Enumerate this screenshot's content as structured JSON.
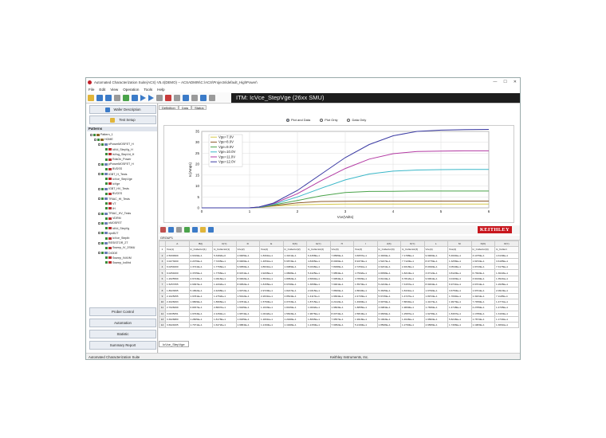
{
  "window": {
    "title": "Automated Characterization Suite(ACS) V5.4(DEMO) -- ACSADMIN\\C:\\ACS\\Projects\\default_HighPower\\",
    "controls": [
      "—",
      "☐",
      "✕"
    ]
  },
  "menu": [
    "File",
    "Edit",
    "View",
    "Operation",
    "Tools",
    "Help"
  ],
  "itm_title": "ITM: IcVce_StepVge (26xx SMU)",
  "left_panel": {
    "wafer_description": "Wafer Description",
    "test_setup": "Test Setup",
    "patterns_header": "Patterns",
    "tree": [
      {
        "label": "Pattern_1",
        "level": 1,
        "kind": "group"
      },
      {
        "label": "HOME",
        "level": 2,
        "kind": "group"
      },
      {
        "label": "nPowerMOSFET_H",
        "level": 3,
        "kind": "dev"
      },
      {
        "label": "IdVd_StepVg_H",
        "level": 4,
        "kind": "itm"
      },
      {
        "label": "IsVsg_StepVd_H",
        "level": 4,
        "kind": "itm"
      },
      {
        "label": "RdsOn_Power",
        "level": 4,
        "kind": "itm"
      },
      {
        "label": "pPowerMOSFET_H",
        "level": 3,
        "kind": "dev"
      },
      {
        "label": "BVDSS",
        "level": 4,
        "kind": "itm"
      },
      {
        "label": "IGBT_H_Tests",
        "level": 3,
        "kind": "dev"
      },
      {
        "label": "IcVce_StepVge",
        "level": 4,
        "kind": "itm"
      },
      {
        "label": "IcVge",
        "level": 4,
        "kind": "itm"
      },
      {
        "label": "IGBT_HV_Tests",
        "level": 3,
        "kind": "dev"
      },
      {
        "label": "BVCES",
        "level": 4,
        "kind": "itm"
      },
      {
        "label": "TRIAC_HI_Tests",
        "level": 3,
        "kind": "dev"
      },
      {
        "label": "VT",
        "level": 4,
        "kind": "itm"
      },
      {
        "label": "IH",
        "level": 4,
        "kind": "itm"
      },
      {
        "label": "TRIAC_HV_Tests",
        "level": 3,
        "kind": "dev"
      },
      {
        "label": "VDRM",
        "level": 4,
        "kind": "itm"
      },
      {
        "label": "nMOSFET",
        "level": 3,
        "kind": "dev"
      },
      {
        "label": "IdVd_StepVg",
        "level": 4,
        "kind": "itm"
      },
      {
        "label": "npnBJT",
        "level": 3,
        "kind": "dev"
      },
      {
        "label": "IcVce_StepIb",
        "level": 4,
        "kind": "itm"
      },
      {
        "label": "RESISTOR_2T",
        "level": 3,
        "kind": "dev"
      },
      {
        "label": "Sweep_IV_2SMU",
        "level": 4,
        "kind": "itm"
      },
      {
        "label": "DIODE",
        "level": 3,
        "kind": "dev"
      },
      {
        "label": "Sweep_IVdVM",
        "level": 4,
        "kind": "itm"
      },
      {
        "label": "Sweep_IvdVrd",
        "level": 4,
        "kind": "itm"
      }
    ],
    "bottom_buttons": [
      "Prober Control",
      "Automation",
      "Statistic",
      "Summary Report"
    ]
  },
  "tabs": [
    "Definition",
    "Data",
    "Status"
  ],
  "active_tab": "Data",
  "radios": [
    {
      "label": "Plot and Data",
      "selected": true
    },
    {
      "label": "Plot Only",
      "selected": false
    },
    {
      "label": "Data Only",
      "selected": false
    }
  ],
  "chart_data": {
    "type": "line",
    "xlabel": "Vce(Volts)",
    "ylabel": "Ic(Amps)",
    "xlim": [
      0,
      6
    ],
    "ylim": [
      0,
      35
    ],
    "xticks": [
      0,
      1,
      2,
      3,
      4,
      5,
      6
    ],
    "yticks": [
      0,
      5,
      10,
      15,
      20,
      25,
      30,
      35
    ],
    "grid": true,
    "legend_position": "top-left",
    "x": [
      0,
      0.5,
      1.0,
      1.2,
      1.5,
      2.0,
      2.5,
      3.0,
      3.5,
      4.0,
      4.5,
      5.0,
      5.5,
      6.0
    ],
    "series": [
      {
        "name": "Vge=7.0V",
        "color": "#d7c94a",
        "values": [
          0,
          0,
          0,
          0.2,
          0.8,
          1.4,
          1.6,
          1.7,
          1.7,
          1.7,
          1.7,
          1.7,
          1.7,
          1.7
        ]
      },
      {
        "name": "Vge=8.0V",
        "color": "#8b5a2b",
        "values": [
          0,
          0,
          0,
          0.2,
          1.0,
          2.3,
          2.9,
          3.0,
          3.1,
          3.1,
          3.1,
          3.1,
          3.1,
          3.1
        ]
      },
      {
        "name": "Vge=9.0V",
        "color": "#4aa34a",
        "values": [
          0,
          0,
          0,
          0.3,
          1.3,
          3.4,
          5.5,
          7.0,
          7.5,
          7.6,
          7.7,
          7.7,
          7.7,
          7.7
        ]
      },
      {
        "name": "Vge=10.0V",
        "color": "#3ab7c8",
        "values": [
          0,
          0,
          0,
          0.3,
          1.6,
          5.0,
          9.0,
          12.8,
          15.5,
          16.8,
          17.3,
          17.5,
          17.6,
          17.6
        ]
      },
      {
        "name": "Vge=11.0V",
        "color": "#b33aa3",
        "values": [
          0,
          0,
          0,
          0.4,
          1.9,
          6.5,
          12.5,
          18.0,
          22.3,
          24.8,
          25.8,
          26.0,
          26.1,
          26.1
        ]
      },
      {
        "name": "Vge=12.0V",
        "color": "#3a3aa3",
        "values": [
          0,
          0,
          0,
          0.4,
          2.2,
          8.0,
          15.5,
          23.0,
          29.0,
          33.0,
          35.0,
          35.6,
          35.8,
          35.9
        ]
      }
    ]
  },
  "brand": "KEITHLEY",
  "sheet": {
    "group_label": "GROUP1",
    "columns": [
      "A",
      "B(I)",
      "C(Y)",
      "D",
      "E",
      "F(X)",
      "G(Y)",
      "H",
      "I",
      "J(X)",
      "K(Y)",
      "L",
      "M",
      "N(X)",
      "O(Y)"
    ],
    "header_row": [
      "Vce(1)",
      "Ic_Collector(1)",
      "Ic_Collector(1)",
      "Vce(2)",
      "Vce(2)",
      "Ic_Collector(2)",
      "Ic_Collector(2)",
      "Vce(3)",
      "Vce(3)",
      "Ic_Collector(3)",
      "Ic_Collector(3)",
      "Vce(4)",
      "Vce(4)",
      "Ic_Collector(4)",
      "Ic_Collect"
    ],
    "rows": [
      [
        "2.5099999",
        "4.6199E+1",
        "5.3482E+0",
        "4.9905E+1",
        "1.8301E+1",
        "1.3161E+1",
        "6.4458E+1",
        "7.8895E+1",
        "3.6657E+1",
        "2.3466E+1",
        "7.1788E+1",
        "9.9906E+1",
        "5.4604E+1",
        "3.1075E+1",
        "4.3139E+1"
      ],
      [
        "3.0273000",
        "2.2076E+1",
        "7.7205E+1",
        "8.9906E+1",
        "1.4651E+1",
        "5.6873E+1",
        "4.8465E+1",
        "8.0006E+1",
        "8.9370E+1",
        "1.5227E+1",
        "7.7120E+1",
        "8.9775E+1",
        "1.3256E+1",
        "1.6972E+1",
        "3.6185E+1"
      ],
      [
        "6.0254000",
        "1.3741E+1",
        "1.7766E+1",
        "9.9950E+1",
        "4.8631E+1",
        "1.0089E+1",
        "5.0346E+1",
        "7.8938E+1",
        "2.7251E+1",
        "2.9231E+1",
        "2.4018E+1",
        "8.0490E+1",
        "3.0540E+1",
        "1.9723E+1",
        "7.3176E+1"
      ],
      [
        "9.0254000",
        "2.3705E+1",
        "1.7766E+1",
        "8.9151E+1",
        "4.9206E+1",
        "1.0808E+1",
        "5.4425E+1",
        "7.9854E+1",
        "4.7502E+1",
        "2.8458E+1",
        "1.8210E+1",
        "3.0712E+1",
        "3.8120E+1",
        "6.7302E+1",
        "1.3022E+1"
      ],
      [
        "1.2025599",
        "2.6743E+1",
        "1.0916E+1",
        "8.9902E+1",
        "1.5531E+1",
        "1.8052E+1",
        "2.6664E+1",
        "7.9954E+1",
        "4.7803E+1",
        "3.8144E+1",
        "6.7812E+1",
        "9.6991E+1",
        "3.0163E+1",
        "3.6019E+1",
        "1.3521E+1"
      ],
      [
        "1.5257055",
        "2.6997E+1",
        "1.2202E+1",
        "8.9952E+1",
        "1.8155E+1",
        "6.6708E+1",
        "1.3658E+1",
        "7.9901E+1",
        "1.5570E+1",
        "5.2223E+1",
        "7.3157E+1",
        "8.9934E+1",
        "6.9731E+1",
        "4.6701E+1",
        "1.2935E+1"
      ],
      [
        "1.8023695",
        "5.1862E+1",
        "2.4298E+1",
        "1.9972E+1",
        "2.9729E+1",
        "1.8247E+1",
        "2.0315E+1",
        "7.8660E+1",
        "2.8840E+1",
        "5.3635E+1",
        "1.8431E+1",
        "1.6790E+1",
        "3.6750E+1",
        "1.9701E+1",
        "2.0913E+1"
      ],
      [
        "2.1025055",
        "1.9781E+1",
        "1.2752E+1",
        "1.5912E+1",
        "2.2631E+1",
        "4.8524E+1",
        "1.4117E+1",
        "1.9664E+1",
        "2.4733E+1",
        "5.6745E+1",
        "1.4727E+1",
        "1.8972E+1",
        "1.7094E+1",
        "1.3181E+1",
        "7.1125E+1"
      ],
      [
        "2.4026093",
        "1.9809E+1",
        "1.8966E+1",
        "1.9781E+1",
        "1.5760E+1",
        "2.0733E+1",
        "1.8715E+1",
        "2.2142E+1",
        "1.4990E+1",
        "3.9979E+1",
        "7.8834E+1",
        "1.4137E+1",
        "1.9973E+1",
        "7.7459E+1",
        "1.4771E+1"
      ],
      [
        "2.7026099",
        "6.8457E+1",
        "2.8807E+1",
        "1.6945E+1",
        "1.1633E+1",
        "1.8195E+1",
        "1.0002E+1",
        "1.9803E+1",
        "1.8855E+1",
        "4.0984E+1",
        "1.9809E+1",
        "1.7836E+1",
        "1.4748E+1",
        "2.2789E+1",
        "1.4705E+1"
      ],
      [
        "3.0035051",
        "1.9763E+1",
        "2.1152E+1",
        "1.9874E+1",
        "1.0042E+1",
        "1.5843E+1",
        "1.9876E+1",
        "8.0074E+1",
        "2.5819E+1",
        "3.9839E+1",
        "1.2587E+1",
        "1.9278E+1",
        "1.8467E+1",
        "1.1786E+1",
        "1.3163E+1"
      ],
      [
        "3.3026880",
        "1.2805E+1",
        "1.8178E+1",
        "1.0935E+1",
        "1.1801E+1",
        "1.2948E+1",
        "1.8065E+1",
        "7.9557E+1",
        "1.9918E+1",
        "5.1993E+1",
        "1.4946E+1",
        "1.9582E+1",
        "5.8246E+1",
        "1.7874E+1",
        "1.1734E+1"
      ],
      [
        "3.6024005",
        "1.7971E+1",
        "1.6472E+1",
        "1.9884E+1",
        "1.2160E+1",
        "1.1948E+1",
        "1.2150E+1",
        "7.9952E+1",
        "5.2190E+1",
        "1.8508E+1",
        "1.2790E+1",
        "4.6895E+1",
        "1.7466E+1",
        "1.1983E+1",
        "1.3061E+1"
      ]
    ]
  },
  "sheet_tabs": [
    "IcVce_StepVge"
  ],
  "status": {
    "left": "Automated Characterization Suite",
    "center": "Keithley Instruments, Inc."
  }
}
